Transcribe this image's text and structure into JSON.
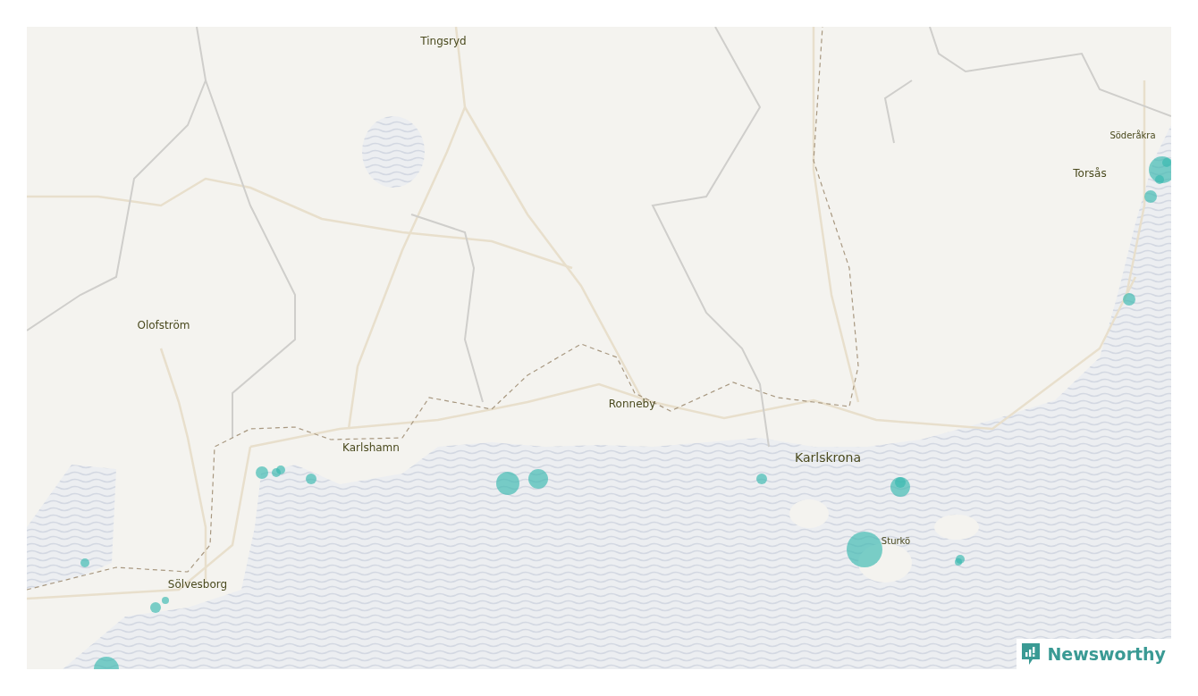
{
  "places": [
    {
      "name": "Tingsryd",
      "kind": "town"
    },
    {
      "name": "Söderåkra",
      "kind": "village"
    },
    {
      "name": "Torsås",
      "kind": "town"
    },
    {
      "name": "Olofström",
      "kind": "town"
    },
    {
      "name": "Ronneby",
      "kind": "town"
    },
    {
      "name": "Karlshamn",
      "kind": "town"
    },
    {
      "name": "Karlskrona",
      "kind": "city"
    },
    {
      "name": "Sturkö",
      "kind": "village"
    },
    {
      "name": "Sölvesborg",
      "kind": "town"
    }
  ],
  "brand": {
    "name": "Newsworthy"
  }
}
